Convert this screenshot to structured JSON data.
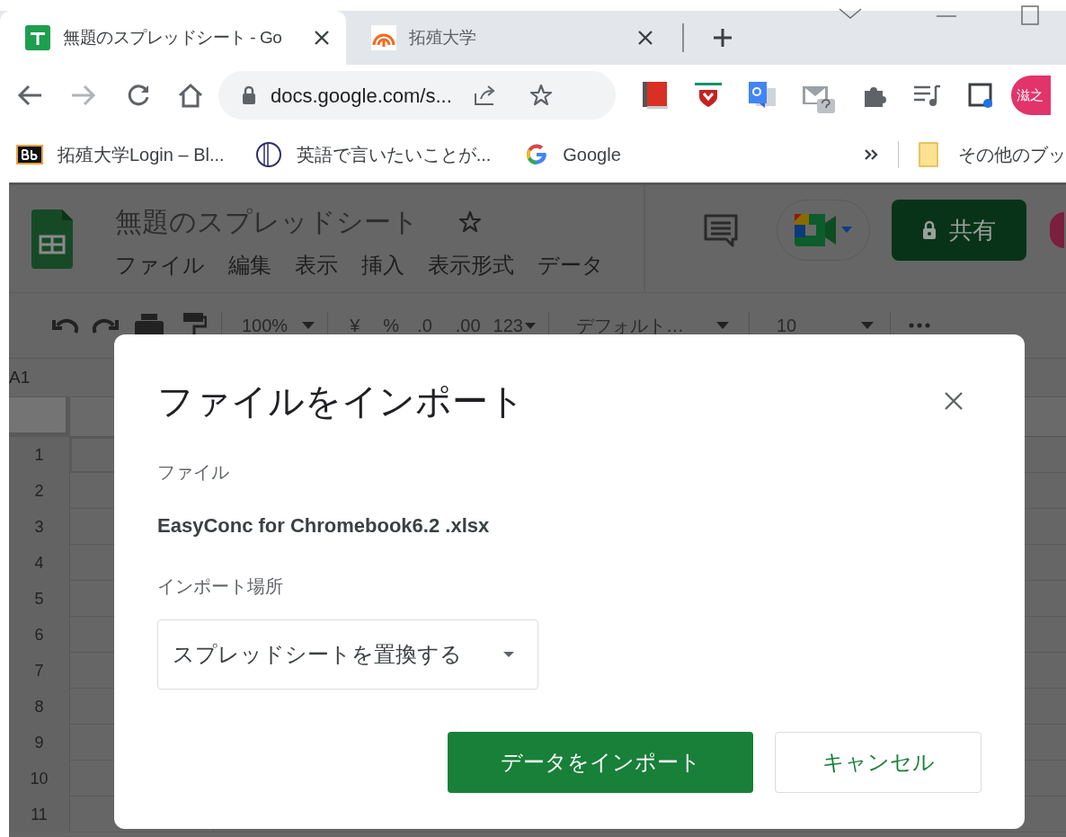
{
  "browser": {
    "tabs": [
      {
        "title": "無題のスプレッドシート - Go",
        "selected": true,
        "kind": "sheets"
      },
      {
        "title": "拓殖大学",
        "selected": false,
        "kind": "arch"
      }
    ],
    "address": "docs.google.com/s...",
    "profile": "滋之",
    "bookmarks": [
      {
        "label": "拓殖大学Login – Bl...",
        "kind": "bb"
      },
      {
        "label": "英語で言いたいことが...",
        "kind": "circle"
      },
      {
        "label": "Google",
        "kind": "google"
      }
    ],
    "other_bookmarks": "その他のブッ"
  },
  "sheets": {
    "title": "無題のスプレッドシート",
    "menus": [
      "ファイル",
      "編集",
      "表示",
      "挿入",
      "表示形式",
      "データ"
    ],
    "share": "共有",
    "toolbar": {
      "zoom": "100%",
      "currency": "¥",
      "percent": "%",
      "decrease_decimal": ".0",
      "increase_decimal": ".00",
      "more_formats": "123",
      "font": "デフォルト…",
      "font_size": "10"
    },
    "name_box": "A1",
    "rows": [
      "1",
      "2",
      "3",
      "4",
      "5",
      "6",
      "7",
      "8",
      "9",
      "10",
      "11"
    ]
  },
  "dialog": {
    "title": "ファイルをインポート",
    "file_label": "ファイル",
    "file_name": "EasyConc for Chromebook6.2 .xlsx",
    "location_label": "インポート場所",
    "location_value": "スプレッドシートを置換する",
    "import_button": "データをインポート",
    "cancel_button": "キャンセル"
  }
}
